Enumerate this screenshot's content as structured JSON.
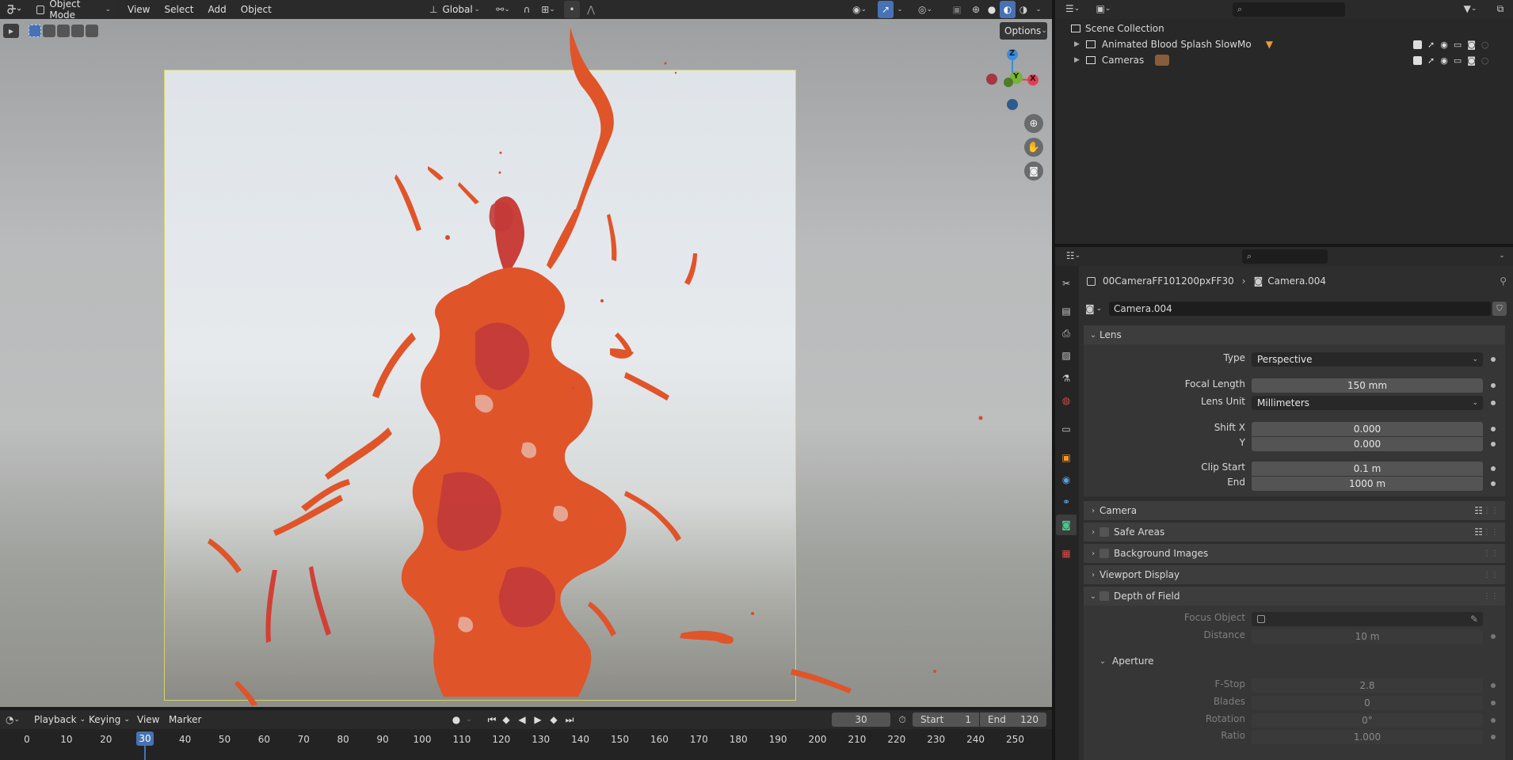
{
  "viewport": {
    "header": {
      "mode": "Object Mode",
      "menus": [
        "View",
        "Select",
        "Add",
        "Object"
      ],
      "orientation": "Global"
    },
    "options_label": "Options",
    "gizmo": {
      "x": "X",
      "y": "Y",
      "z": "Z"
    }
  },
  "timeline": {
    "menus": [
      "Playback",
      "Keying",
      "View",
      "Marker"
    ],
    "current_frame": "30",
    "start_label": "Start",
    "start_value": "1",
    "end_label": "End",
    "end_value": "120",
    "ticks": [
      "0",
      "10",
      "20",
      "30",
      "40",
      "50",
      "60",
      "70",
      "80",
      "90",
      "100",
      "110",
      "120",
      "130",
      "140",
      "150",
      "160",
      "170",
      "180",
      "190",
      "200",
      "210",
      "220",
      "230",
      "240",
      "250"
    ]
  },
  "outliner": {
    "root": "Scene Collection",
    "items": [
      "Animated Blood Splash SlowMo",
      "Cameras"
    ]
  },
  "properties": {
    "breadcrumb_object": "00CameraFF101200pxFF30",
    "breadcrumb_data": "Camera.004",
    "data_name": "Camera.004",
    "lens": {
      "title": "Lens",
      "type_label": "Type",
      "type_value": "Perspective",
      "focal_label": "Focal Length",
      "focal_value": "150 mm",
      "unit_label": "Lens Unit",
      "unit_value": "Millimeters",
      "shiftx_label": "Shift X",
      "shiftx_value": "0.000",
      "shifty_label": "Y",
      "shifty_value": "0.000",
      "clipstart_label": "Clip Start",
      "clipstart_value": "0.1 m",
      "clipend_label": "End",
      "clipend_value": "1000 m"
    },
    "panels": {
      "camera": "Camera",
      "safe_areas": "Safe Areas",
      "background_images": "Background Images",
      "viewport_display": "Viewport Display",
      "dof": "Depth of Field"
    },
    "dof": {
      "focus_label": "Focus Object",
      "distance_label": "Distance",
      "distance_value": "10 m",
      "aperture_title": "Aperture",
      "fstop_label": "F-Stop",
      "fstop_value": "2.8",
      "blades_label": "Blades",
      "blades_value": "0",
      "rotation_label": "Rotation",
      "rotation_value": "0°",
      "ratio_label": "Ratio",
      "ratio_value": "1.000"
    }
  }
}
